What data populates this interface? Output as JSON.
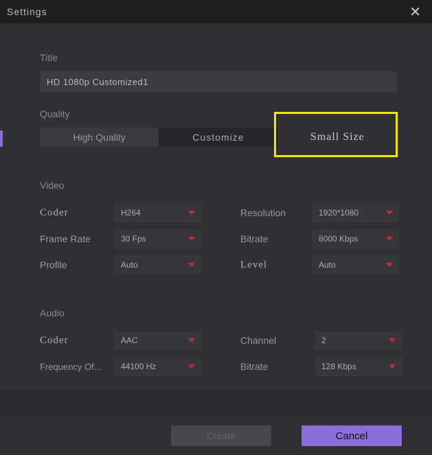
{
  "header": {
    "title": "Settings"
  },
  "title": {
    "label": "Title",
    "value": "HD 1080p Customized1"
  },
  "quality": {
    "label": "Quality",
    "options": {
      "high": "High Quality",
      "customize": "Customize",
      "small": "Small Size"
    }
  },
  "video": {
    "label": "Video",
    "coder": {
      "label": "Coder",
      "value": "H264"
    },
    "resolution": {
      "label": "Resolution",
      "value": "1920*1080"
    },
    "framerate": {
      "label": "Frame Rate",
      "value": "30 Fps"
    },
    "bitrate": {
      "label": "Bitrate",
      "value": "8000 Kbps"
    },
    "profile": {
      "label": "Profile",
      "value": "Auto"
    },
    "level": {
      "label": "Level",
      "value": "Auto"
    }
  },
  "audio": {
    "label": "Audio",
    "coder": {
      "label": "Coder",
      "value": "AAC"
    },
    "channel": {
      "label": "Channel",
      "value": "2"
    },
    "frequency": {
      "label": "Frequency Of...",
      "value": "44100 Hz"
    },
    "bitrate": {
      "label": "Bitrate",
      "value": "128 Kbps"
    }
  },
  "footer": {
    "create": "Create",
    "cancel": "Cancel"
  }
}
